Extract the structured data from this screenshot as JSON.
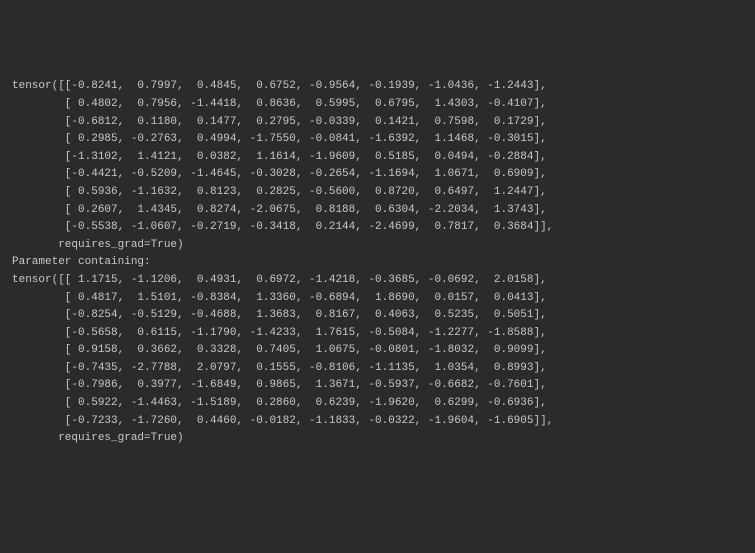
{
  "tensors": [
    {
      "rows": [
        [
          "-0.8241",
          " 0.7997",
          " 0.4845",
          " 0.6752",
          "-0.9564",
          "-0.1939",
          "-1.0436",
          "-1.2443"
        ],
        [
          " 0.4802",
          " 0.7956",
          "-1.4418",
          " 0.8636",
          " 0.5995",
          " 0.6795",
          " 1.4303",
          "-0.4107"
        ],
        [
          "-0.6812",
          " 0.1180",
          " 0.1477",
          " 0.2795",
          "-0.0339",
          " 0.1421",
          " 0.7598",
          " 0.1729"
        ],
        [
          " 0.2985",
          "-0.2763",
          " 0.4994",
          "-1.7550",
          "-0.0841",
          "-1.6392",
          " 1.1468",
          "-0.3015"
        ],
        [
          "-1.3102",
          " 1.4121",
          " 0.0382",
          " 1.1614",
          "-1.9609",
          " 0.5185",
          " 0.0494",
          "-0.2884"
        ],
        [
          "-0.4421",
          "-0.5209",
          "-1.4645",
          "-0.3028",
          "-0.2654",
          "-1.1694",
          " 1.0671",
          " 0.6909"
        ],
        [
          " 0.5936",
          "-1.1632",
          " 0.8123",
          " 0.2825",
          "-0.5600",
          " 0.8720",
          " 0.6497",
          " 1.2447"
        ],
        [
          " 0.2607",
          " 1.4345",
          " 0.8274",
          "-2.0675",
          " 0.8188",
          " 0.6304",
          "-2.2034",
          " 1.3743"
        ],
        [
          "-0.5538",
          "-1.0607",
          "-0.2719",
          "-0.3418",
          " 0.2144",
          "-2.4699",
          " 0.7817",
          " 0.3684"
        ]
      ],
      "requires_grad_label": "requires_grad=True"
    },
    {
      "rows": [
        [
          " 1.1715",
          "-1.1206",
          " 0.4931",
          " 0.6972",
          "-1.4218",
          "-0.3685",
          "-0.0692",
          " 2.0158"
        ],
        [
          " 0.4817",
          " 1.5101",
          "-0.8384",
          " 1.3360",
          "-0.6894",
          " 1.8690",
          " 0.0157",
          " 0.0413"
        ],
        [
          "-0.8254",
          "-0.5129",
          "-0.4688",
          " 1.3683",
          " 0.8167",
          " 0.4063",
          " 0.5235",
          " 0.5051"
        ],
        [
          "-0.5658",
          " 0.6115",
          "-1.1790",
          "-1.4233",
          " 1.7615",
          "-0.5084",
          "-1.2277",
          "-1.8588"
        ],
        [
          " 0.9158",
          " 0.3662",
          " 0.3328",
          " 0.7405",
          " 1.0675",
          "-0.0801",
          "-1.8032",
          " 0.9099"
        ],
        [
          "-0.7435",
          "-2.7788",
          " 2.0797",
          " 0.1555",
          "-0.8106",
          "-1.1135",
          " 1.0354",
          " 0.8993"
        ],
        [
          "-0.7986",
          " 0.3977",
          "-1.6849",
          " 0.9865",
          " 1.3671",
          "-0.5937",
          "-0.6682",
          "-0.7601"
        ],
        [
          " 0.5922",
          "-1.4463",
          "-1.5189",
          " 0.2860",
          " 0.6239",
          "-1.9620",
          " 0.6299",
          "-0.6936"
        ],
        [
          "-0.7233",
          "-1.7260",
          " 0.4460",
          "-0.0182",
          "-1.1833",
          "-0.0322",
          "-1.9604",
          "-1.6905"
        ]
      ],
      "requires_grad_label": "requires_grad=True"
    }
  ],
  "tensor_keyword": "tensor",
  "parameter_containing_label": "Parameter containing:"
}
